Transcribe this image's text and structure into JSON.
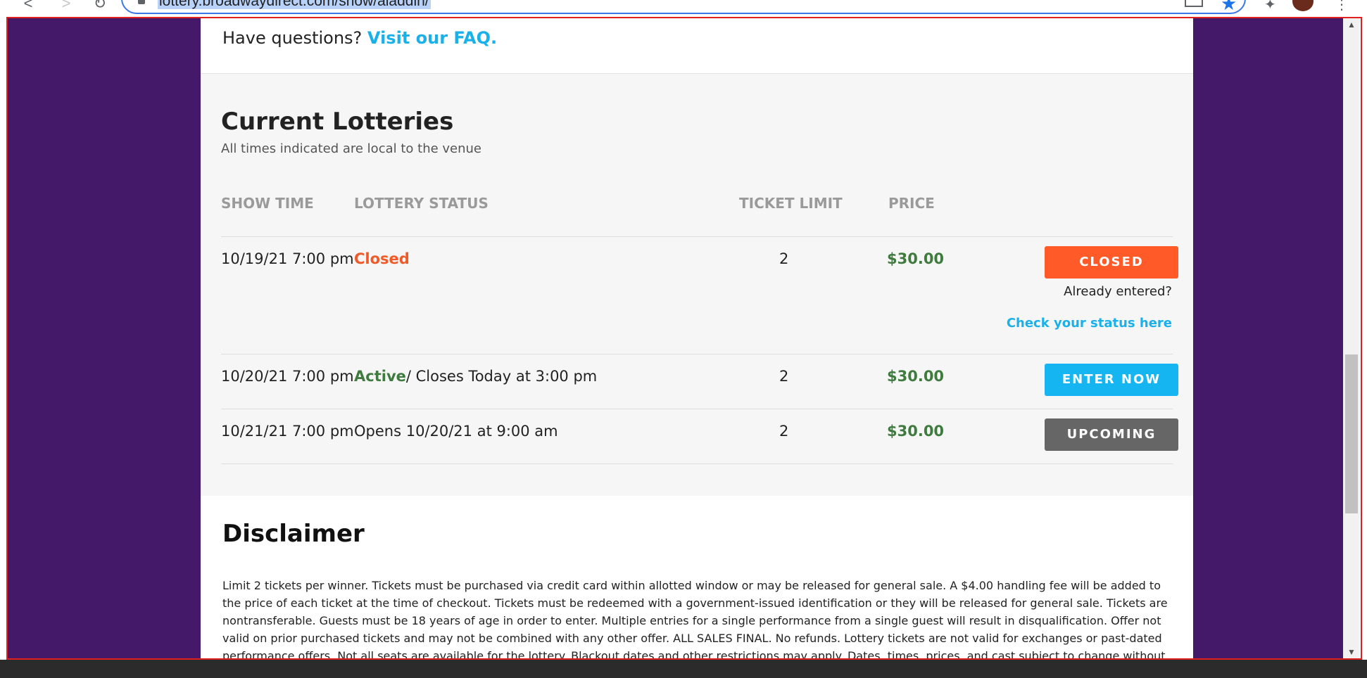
{
  "browser": {
    "url": "lottery.broadwaydirect.com/show/aladdin/",
    "back_glyph": "<",
    "forward_glyph": ">",
    "reload_glyph": "↻",
    "star_glyph": "★",
    "extensions_glyph": "✦",
    "menu_glyph": "⋮"
  },
  "faq": {
    "question": "Have questions? ",
    "link": "Visit our FAQ."
  },
  "lotteries": {
    "title": "Current Lotteries",
    "subtitle": "All times indicated are local to the venue",
    "columns": {
      "show_time": "SHOW TIME",
      "status": "LOTTERY STATUS",
      "ticket_limit": "TICKET LIMIT",
      "price": "PRICE"
    },
    "rows": [
      {
        "show_time": "10/19/21 7:00 pm",
        "status": "Closed",
        "status_suffix": "",
        "ticket_limit": "2",
        "price": "$30.00",
        "button": "CLOSED",
        "already_entered": "Already entered?",
        "check_status": "Check your status here"
      },
      {
        "show_time": "10/20/21 7:00 pm",
        "status": "Active",
        "status_suffix": "/ Closes Today at 3:00 pm",
        "ticket_limit": "2",
        "price": "$30.00",
        "button": "ENTER NOW"
      },
      {
        "show_time": "10/21/21 7:00 pm",
        "status": "Opens 10/20/21 at 9:00 am",
        "status_suffix": "",
        "ticket_limit": "2",
        "price": "$30.00",
        "button": "UPCOMING"
      }
    ]
  },
  "disclaimer": {
    "title": "Disclaimer",
    "body": "Limit 2 tickets per winner. Tickets must be purchased via credit card within allotted window or may be released for general sale. A $4.00 handling fee will be added to the price of each ticket at the time of checkout. Tickets must be redeemed with a government-issued identification or they will be released for general sale. Tickets are nontransferable. Guests must be 18 years of age in order to enter. Multiple entries for a single performance from a single guest will result in disqualification. Offer not valid on prior purchased tickets and may not be combined with any other offer. ALL SALES FINAL. No refunds. Lottery tickets are not valid for exchanges or past-dated performance offers. Not all seats are available for the lottery. Blackout dates and other restrictions may apply. Dates, times, prices, and cast subject to change without"
  },
  "colors": {
    "page_background": "#45196a",
    "closed": "#ff5a28",
    "enter": "#14b5f0",
    "upcoming": "#666666",
    "price": "#3f7b3f",
    "link": "#1ab0ea"
  }
}
